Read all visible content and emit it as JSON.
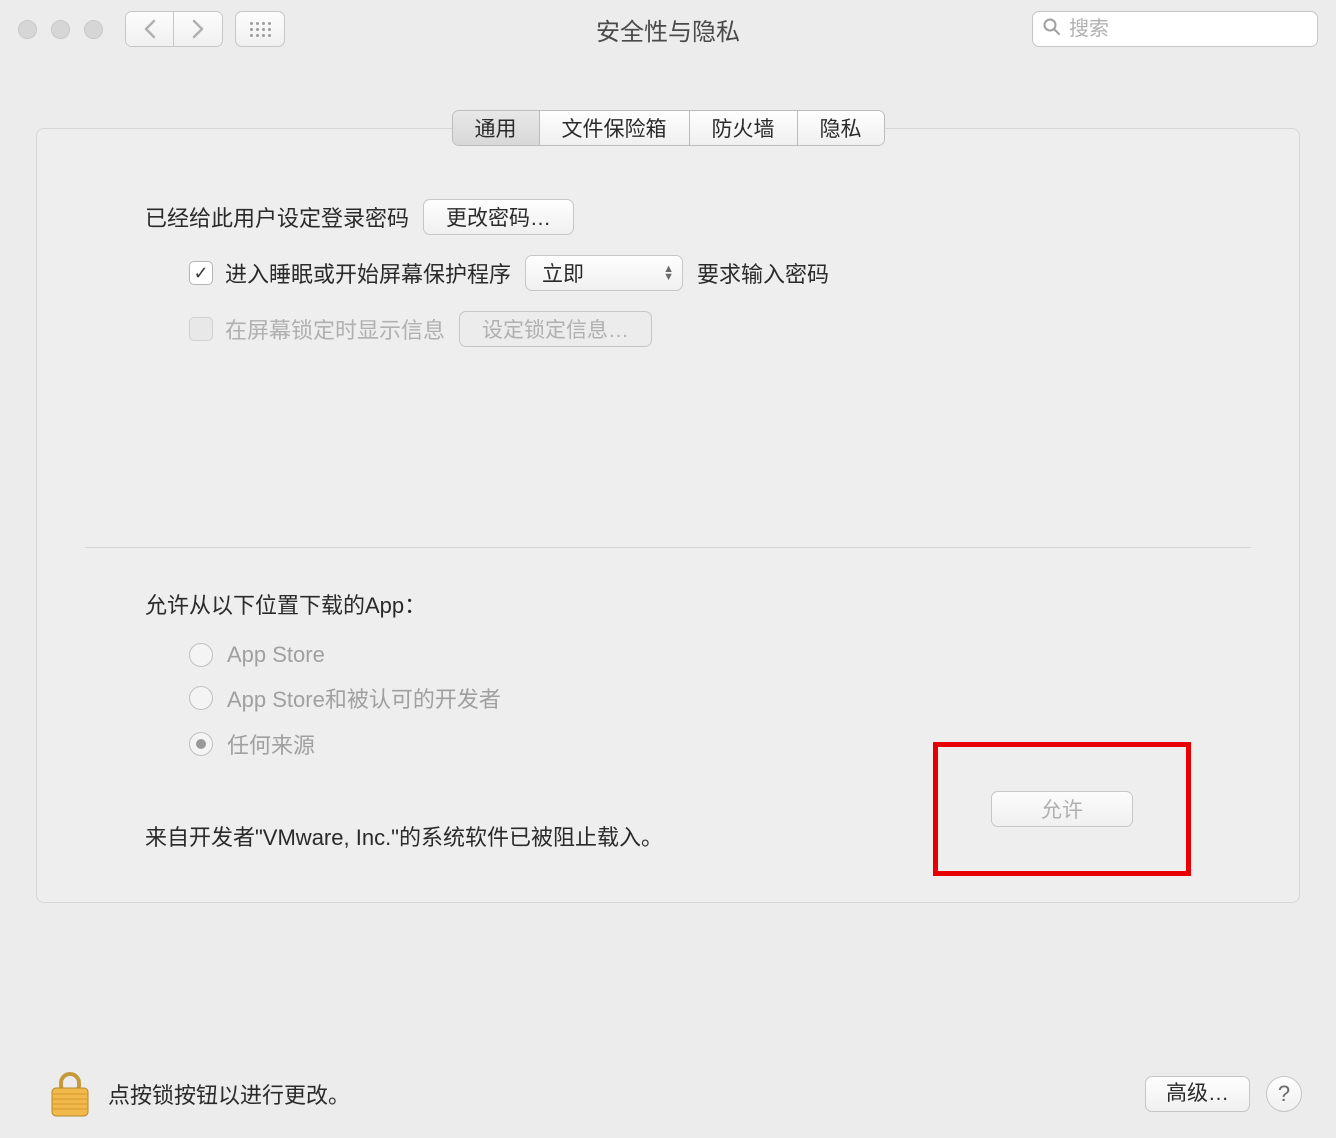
{
  "window": {
    "title": "安全性与隐私",
    "search_placeholder": "搜索"
  },
  "tabs": {
    "general": "通用",
    "filevault": "文件保险箱",
    "firewall": "防火墙",
    "privacy": "隐私"
  },
  "general": {
    "password_set_label": "已经给此用户设定登录密码",
    "change_password_btn": "更改密码…",
    "require_password_prefix": "进入睡眠或开始屏幕保护程序",
    "require_password_timing": "立即",
    "require_password_suffix": "要求输入密码",
    "show_message_label": "在屏幕锁定时显示信息",
    "set_lock_message_btn": "设定锁定信息…",
    "allow_apps_label": "允许从以下位置下载的App：",
    "radio_appstore": "App Store",
    "radio_identified": "App Store和被认可的开发者",
    "radio_anywhere": "任何来源",
    "blocked_message": "来自开发者\"VMware, Inc.\"的系统软件已被阻止载入。",
    "allow_btn": "允许"
  },
  "footer": {
    "lock_text": "点按锁按钮以进行更改。",
    "advanced_btn": "高级…",
    "help": "?"
  }
}
